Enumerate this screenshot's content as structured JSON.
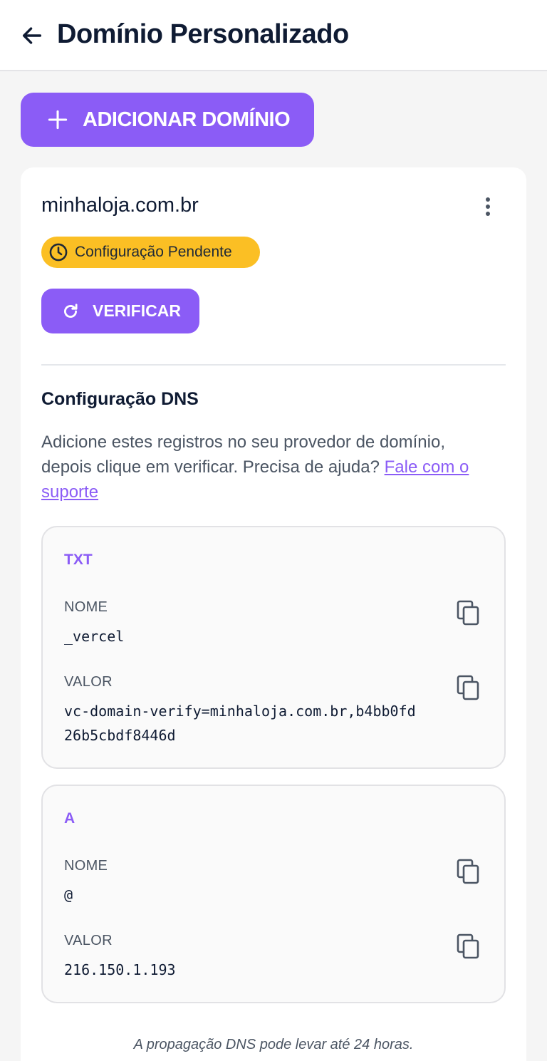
{
  "header": {
    "title": "Domínio Personalizado",
    "back_icon": "arrow-left-icon"
  },
  "add_button": {
    "label": "ADICIONAR DOMÍNIO",
    "icon": "plus-icon"
  },
  "domain": {
    "name": "minhaloja.com.br",
    "menu_icon": "more-vert-icon",
    "status": {
      "label": "Configuração Pendente",
      "icon": "clock-icon",
      "color": "#fbbf24"
    },
    "verify_button": {
      "label": "VERIFICAR",
      "icon": "refresh-icon"
    }
  },
  "dns": {
    "title": "Configuração DNS",
    "description": "Adicione estes registros no seu provedor de domínio, depois clique em verificar. Precisa de ajuda?",
    "support_link": "Fale com o suporte",
    "records": [
      {
        "type": "TXT",
        "name_label": "NOME",
        "name": "_vercel",
        "value_label": "VALOR",
        "value": "vc-domain-verify=minhaloja.com.br,b4bb0fd\n26b5cbdf8446d"
      },
      {
        "type": "A",
        "name_label": "NOME",
        "name": "@",
        "value_label": "VALOR",
        "value": "216.150.1.193"
      }
    ]
  },
  "footer_note": "A propagação DNS pode levar até 24 horas.",
  "colors": {
    "accent": "#8b5cf6",
    "warning": "#fbbf24",
    "text": "#0f1b33"
  }
}
